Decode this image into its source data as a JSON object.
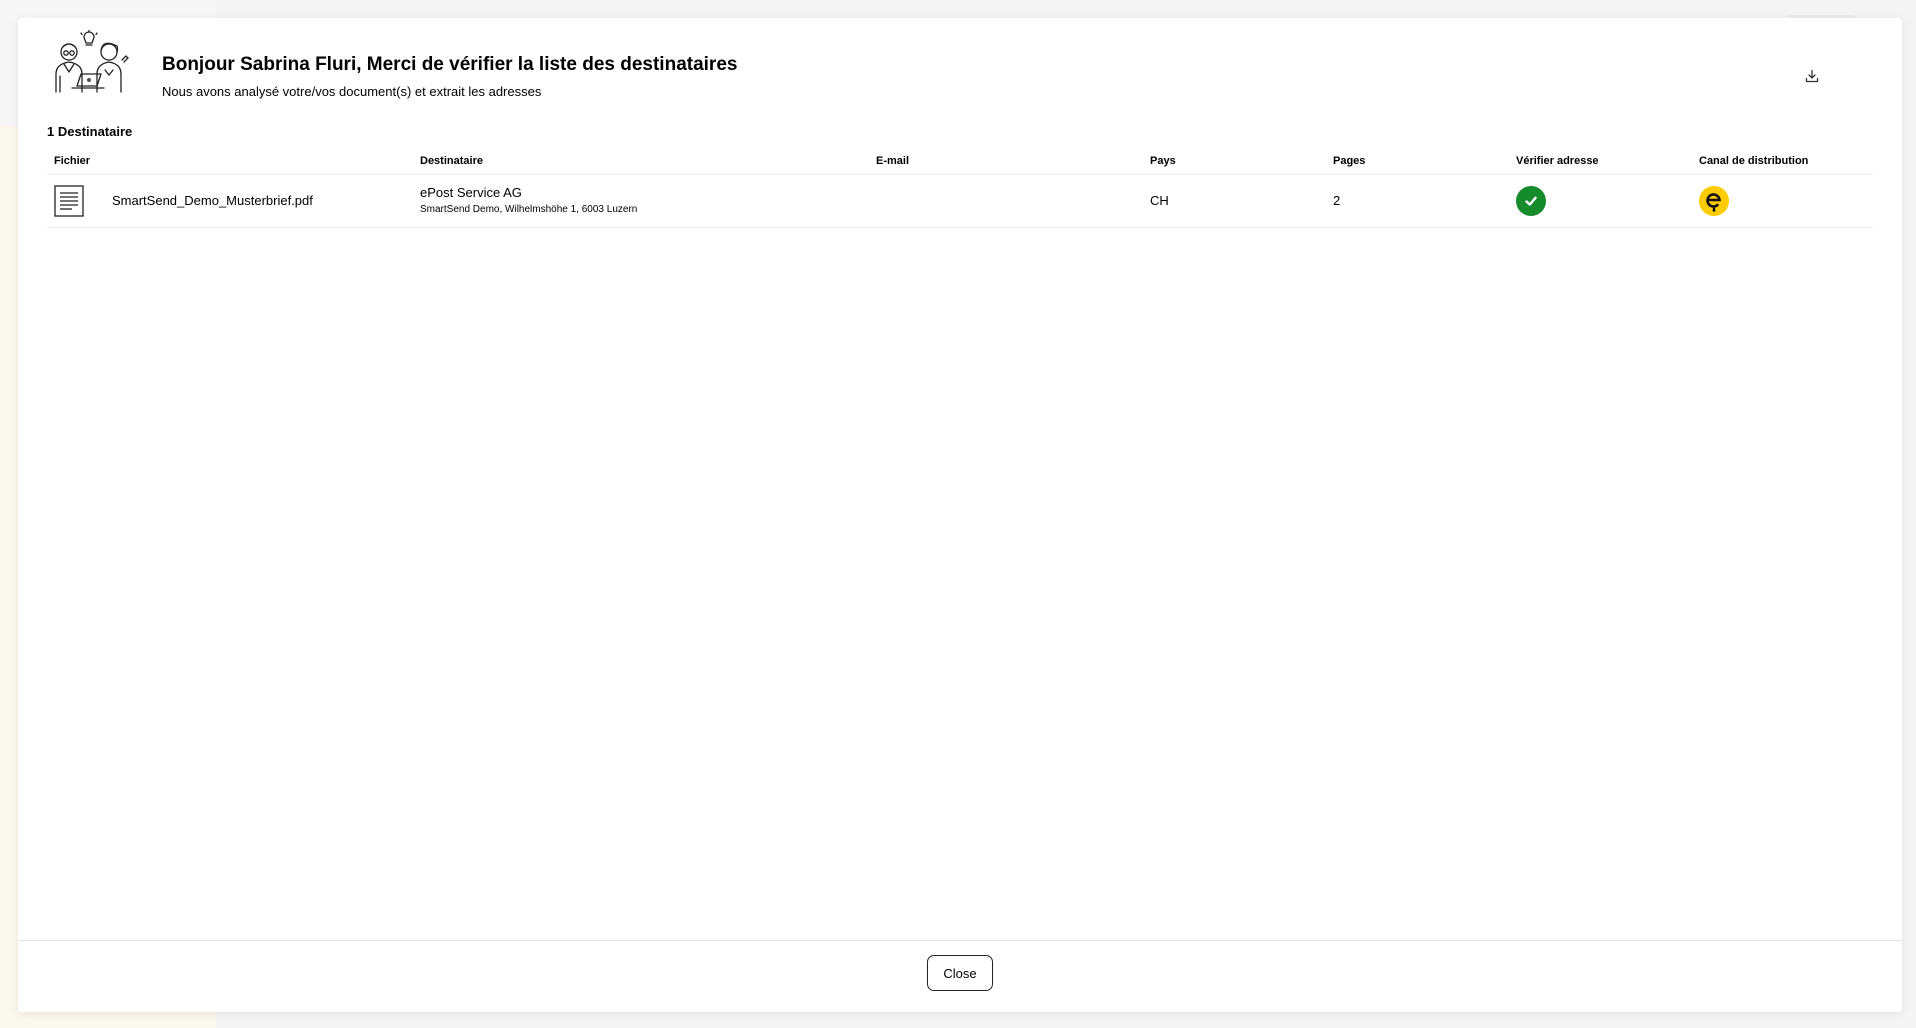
{
  "modal": {
    "title": "Bonjour Sabrina Fluri, Merci de vérifier la liste des destinataires",
    "subtitle": "Nous avons analysé votre/vos document(s) et extrait les adresses",
    "download_icon": "download-icon",
    "illustration_icon": "people-with-laptop-illustration"
  },
  "recipients": {
    "count_label": "1 Destinataire",
    "columns": [
      "Fichier",
      "Destinataire",
      "E-mail",
      "Pays",
      "Pages",
      "Vérifier adresse",
      "Canal de distribution"
    ],
    "rows": [
      {
        "file": "SmartSend_Demo_Musterbrief.pdf",
        "file_icon": "document-icon",
        "recipient_name": "ePost Service AG",
        "recipient_address": "SmartSend Demo, Wilhelmshöhe 1, 6003 Luzern",
        "email": "",
        "country": "CH",
        "pages": "2",
        "verify_icon": "check-circle-icon",
        "verify_color": "#168b2c",
        "channel_icon": "epost-icon",
        "channel_color": "#ffcc00"
      }
    ]
  },
  "footer": {
    "close_label": "Close"
  }
}
